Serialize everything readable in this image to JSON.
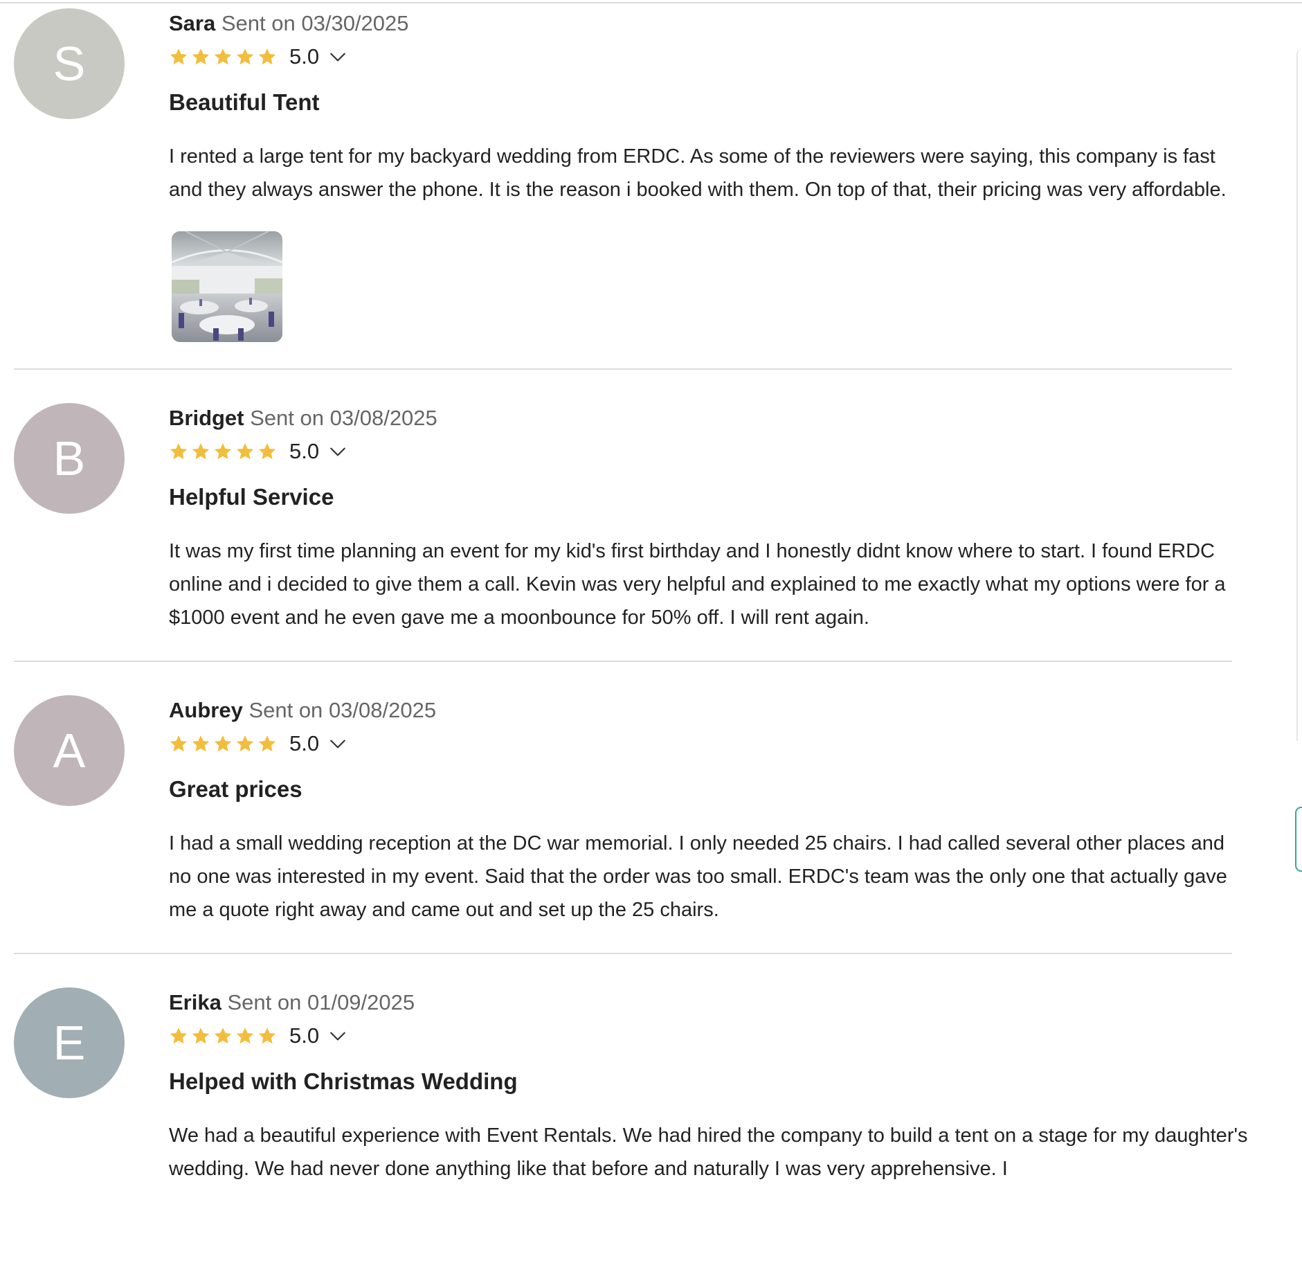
{
  "colors": {
    "star": "#f3bd3c",
    "divider": "#dddddd",
    "secondary_text": "#666666"
  },
  "reviews": [
    {
      "initial": "S",
      "avatar_color": "#c8c9c2",
      "name": "Sara",
      "sent_label": "Sent on",
      "date": "03/30/2025",
      "stars": 5,
      "rating": "5.0",
      "title": "Beautiful Tent",
      "body": "I rented a large tent for my backyard wedding from ERDC. As some of the reviewers were saying, this company is fast and they always answer the phone. It is the reason i booked with them. On top of that, their pricing was very affordable.",
      "has_photo": true
    },
    {
      "initial": "B",
      "avatar_color": "#c0b5b9",
      "name": "Bridget",
      "sent_label": "Sent on",
      "date": "03/08/2025",
      "stars": 5,
      "rating": "5.0",
      "title": "Helpful Service",
      "body": "It was my first time planning an event for my kid's first birthday and I honestly didnt know where to start. I found ERDC online and i decided to give them a call. Kevin was very helpful and explained to me exactly what my options were for a $1000 event and he even gave me a moonbounce for 50% off. I will rent again.",
      "has_photo": false
    },
    {
      "initial": "A",
      "avatar_color": "#c0b5b9",
      "name": "Aubrey",
      "sent_label": "Sent on",
      "date": "03/08/2025",
      "stars": 5,
      "rating": "5.0",
      "title": "Great prices",
      "body": "I had a small wedding reception at the DC war memorial. I only needed 25 chairs. I had called several other places and no one was interested in my event. Said that the order was too small. ERDC's team was the only one that actually gave me a quote right away and came out and set up the 25 chairs.",
      "has_photo": false
    },
    {
      "initial": "E",
      "avatar_color": "#a1aeb3",
      "name": "Erika",
      "sent_label": "Sent on",
      "date": "01/09/2025",
      "stars": 5,
      "rating": "5.0",
      "title": "Helped with Christmas Wedding",
      "body": "We had a beautiful experience with Event Rentals. We had hired the company to build a tent on a stage for my daughter's wedding. We had never done anything like that before and naturally I was very apprehensive. I",
      "has_photo": false
    }
  ]
}
